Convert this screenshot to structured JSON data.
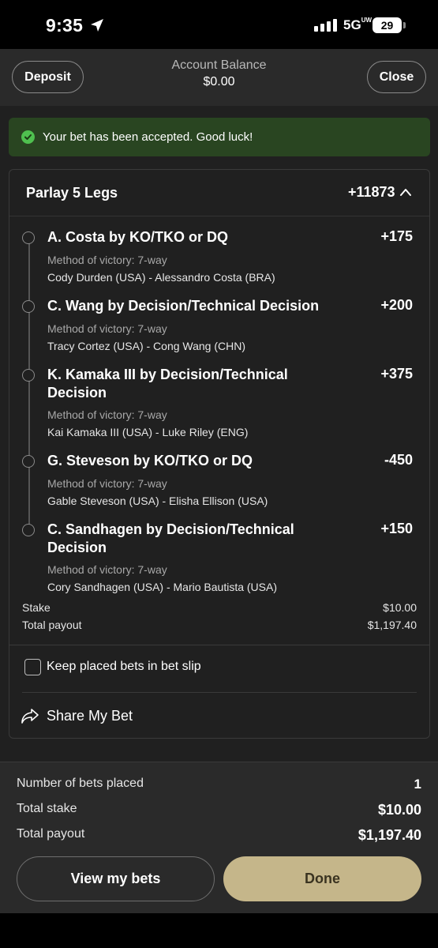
{
  "status_bar": {
    "time": "9:35",
    "network": "5G",
    "network_sup": "UW",
    "battery": "29"
  },
  "header": {
    "deposit_label": "Deposit",
    "balance_label": "Account Balance",
    "balance_value": "$0.00",
    "close_label": "Close"
  },
  "banner": {
    "text": "Your bet has been accepted. Good luck!",
    "color": "#294521"
  },
  "parlay": {
    "title": "Parlay 5 Legs",
    "odds": "+11873",
    "legs": [
      {
        "selection": "A. Costa by KO/TKO or DQ",
        "odds": "+175",
        "market": "Method of victory: 7-way",
        "event": "Cody Durden (USA) - Alessandro Costa (BRA)"
      },
      {
        "selection": "C. Wang by Decision/Technical Decision",
        "odds": "+200",
        "market": "Method of victory: 7-way",
        "event": "Tracy Cortez (USA) - Cong Wang (CHN)"
      },
      {
        "selection": "K. Kamaka III by Decision/Technical Decision",
        "odds": "+375",
        "market": "Method of victory: 7-way",
        "event": "Kai Kamaka III (USA) - Luke Riley (ENG)"
      },
      {
        "selection": "G. Steveson by KO/TKO or DQ",
        "odds": "-450",
        "market": "Method of victory: 7-way",
        "event": "Gable Steveson (USA) - Elisha Ellison (USA)"
      },
      {
        "selection": "C. Sandhagen by Decision/Technical Decision",
        "odds": "+150",
        "market": "Method of victory: 7-way",
        "event": "Cory Sandhagen (USA) - Mario Bautista (USA)"
      }
    ],
    "stake_label": "Stake",
    "stake_value": "$10.00",
    "payout_label": "Total payout",
    "payout_value": "$1,197.40",
    "keep_bets_label": "Keep placed bets in bet slip",
    "keep_bets_checked": false,
    "share_label": "Share My Bet"
  },
  "summary": {
    "bets_placed_label": "Number of bets placed",
    "bets_placed_value": "1",
    "total_stake_label": "Total stake",
    "total_stake_value": "$10.00",
    "total_payout_label": "Total payout",
    "total_payout_value": "$1,197.40",
    "view_bets_label": "View my bets",
    "done_label": "Done",
    "accent_color": "#c5b68a"
  }
}
